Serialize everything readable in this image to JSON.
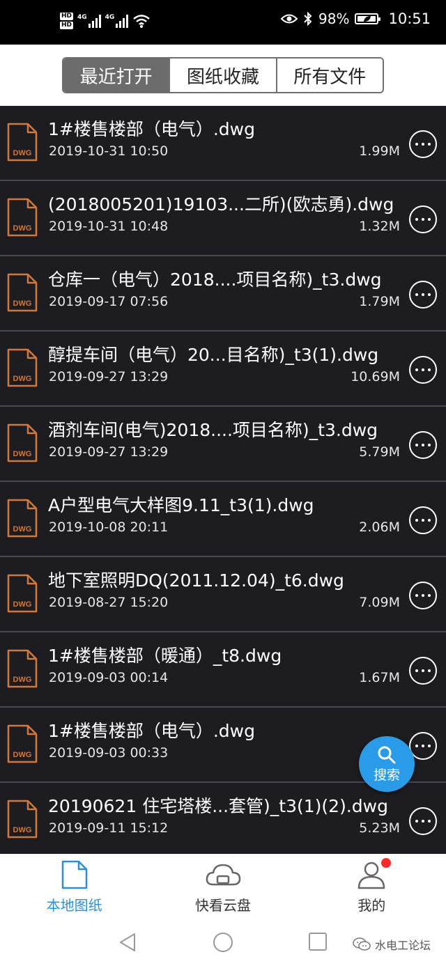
{
  "status_bar": {
    "hd_badges": [
      "HD",
      "HD"
    ],
    "network_labels": [
      "4G",
      "4G"
    ],
    "battery_percent": "98%",
    "battery_level": 0.98,
    "clock": "10:51",
    "icons": [
      "eye-icon",
      "bluetooth-icon",
      "battery-icon",
      "wifi-icon"
    ]
  },
  "tabs": [
    {
      "label": "最近打开",
      "active": true
    },
    {
      "label": "图纸收藏",
      "active": false
    },
    {
      "label": "所有文件",
      "active": false
    }
  ],
  "files": [
    {
      "name": "1#楼售楼部（电气）.dwg",
      "date": "2019-10-31 10:50",
      "size": "1.99M"
    },
    {
      "name": "(2018005201)19103...二所)(欧志勇).dwg",
      "date": "2019-10-31 10:48",
      "size": "1.32M"
    },
    {
      "name": "仓库一（电气）2018....项目名称)_t3.dwg",
      "date": "2019-09-17 07:56",
      "size": "1.79M"
    },
    {
      "name": "醇提车间（电气）20...目名称)_t3(1).dwg",
      "date": "2019-09-27 13:29",
      "size": "10.69M"
    },
    {
      "name": "酒剂车间(电气)2018....项目名称)_t3.dwg",
      "date": "2019-09-27 13:29",
      "size": "5.79M"
    },
    {
      "name": "A户型电气大样图9.11_t3(1).dwg",
      "date": "2019-10-08 20:11",
      "size": "2.06M"
    },
    {
      "name": "地下室照明DQ(2011.12.04)_t6.dwg",
      "date": "2019-08-27 15:20",
      "size": "7.09M"
    },
    {
      "name": "1#楼售楼部（暖通）_t8.dwg",
      "date": "2019-09-03 00:14",
      "size": "1.67M"
    },
    {
      "name": "1#楼售楼部（电气）.dwg",
      "date": "2019-09-03 00:33",
      "size": ""
    },
    {
      "name": "20190621 住宅塔楼...套管)_t3(1)(2).dwg",
      "date": "2019-09-11 15:12",
      "size": "5.23M"
    }
  ],
  "file_icon_label": "DWG",
  "fab": {
    "label": "搜索",
    "icon": "search-icon",
    "color": "#2a9be8"
  },
  "bottom_nav": [
    {
      "label": "本地图纸",
      "icon": "document-icon",
      "active": true
    },
    {
      "label": "快看云盘",
      "icon": "cloud-icon",
      "active": false
    },
    {
      "label": "我的",
      "icon": "user-icon",
      "active": false,
      "notification": true
    }
  ],
  "watermark": {
    "text": "水电工论坛",
    "icon": "wechat-icon"
  },
  "colors": {
    "accent": "#2a8fd8",
    "list_background": "#1c1c21",
    "file_icon": "#d4783a",
    "notification": "#ff2a2a"
  }
}
